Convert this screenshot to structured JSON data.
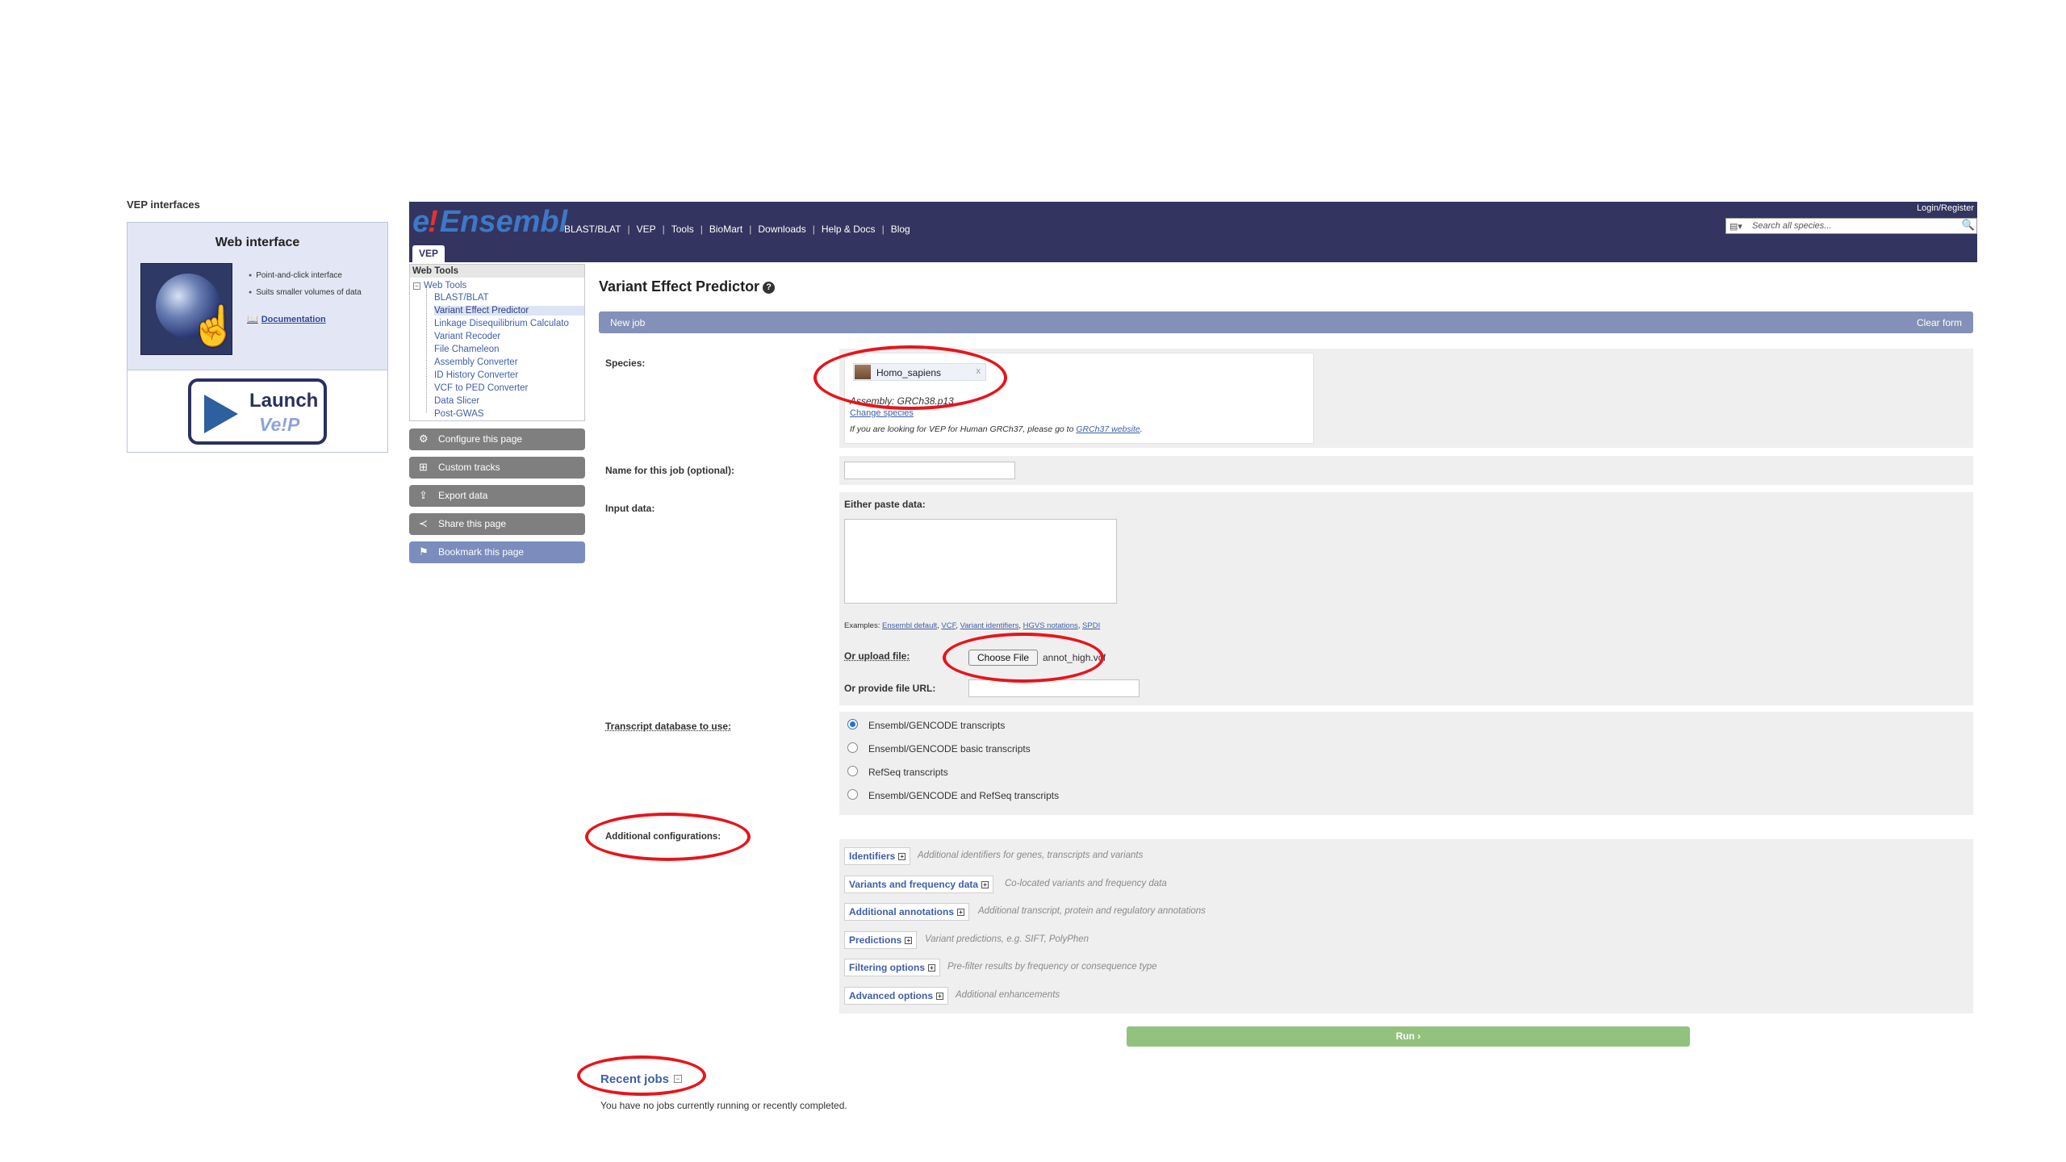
{
  "left_panel": {
    "heading": "VEP interfaces",
    "box_title": "Web interface",
    "features": [
      "Point-and-click interface",
      "Suits smaller volumes of data"
    ],
    "doc_link": "Documentation",
    "launch_line1": "Launch",
    "launch_line2": "Ve!P"
  },
  "header": {
    "logo_e": "e",
    "logo_bang": "!",
    "logo_text": "Ensembl",
    "nav": [
      "BLAST/BLAT",
      "VEP",
      "Tools",
      "BioMart",
      "Downloads",
      "Help & Docs",
      "Blog"
    ],
    "login": "Login/Register",
    "search_placeholder": "Search all species...",
    "tab": "VEP"
  },
  "sidebar": {
    "heading": "Web Tools",
    "root": "Web Tools",
    "items": [
      "BLAST/BLAT",
      "Variant Effect Predictor",
      "Linkage Disequilibrium Calculato",
      "Variant Recoder",
      "File Chameleon",
      "Assembly Converter",
      "ID History Converter",
      "VCF to PED Converter",
      "Data Slicer",
      "Post-GWAS"
    ],
    "selected_index": 1,
    "buttons": [
      {
        "label": "Configure this page",
        "icon": "gear-icon"
      },
      {
        "label": "Custom tracks",
        "icon": "custom-tracks-icon"
      },
      {
        "label": "Export data",
        "icon": "export-icon"
      },
      {
        "label": "Share this page",
        "icon": "share-icon"
      },
      {
        "label": "Bookmark this page",
        "icon": "bookmark-icon"
      }
    ]
  },
  "main": {
    "title": "Variant Effect Predictor",
    "new_job": "New job",
    "clear_form": "Clear form",
    "species_label": "Species:",
    "species_name": "Homo_sapiens",
    "species_remove": "x",
    "assembly": "Assembly: GRCh38.p13",
    "change_species": "Change species",
    "grch37_note_prefix": "If you are looking for VEP for Human GRCh37, please go to ",
    "grch37_link": "GRCh37 website",
    "grch37_note_suffix": ".",
    "job_name_label": "Name for this job (optional):",
    "job_name_value": "",
    "input_label": "Input data:",
    "paste_label": "Either paste data:",
    "paste_value": "",
    "examples_label": "Examples: ",
    "examples": [
      "Ensembl default",
      "VCF",
      "Variant identifiers",
      "HGVS notations",
      "SPDI"
    ],
    "upload_label": "Or upload file:",
    "choose_file": "Choose File",
    "file_name": "annot_high.vcf",
    "url_label": "Or provide file URL:",
    "url_value": "",
    "transcript_label": "Transcript database to use:",
    "transcript_options": [
      "Ensembl/GENCODE transcripts",
      "Ensembl/GENCODE basic transcripts",
      "RefSeq transcripts",
      "Ensembl/GENCODE and RefSeq transcripts"
    ],
    "transcript_selected": 0,
    "additional_label": "Additional configurations:",
    "configs": [
      {
        "label": "Identifiers",
        "desc": "Additional identifiers for genes, transcripts and variants"
      },
      {
        "label": "Variants and frequency data",
        "desc": "Co-located variants and frequency data"
      },
      {
        "label": "Additional annotations",
        "desc": "Additional transcript, protein and regulatory annotations"
      },
      {
        "label": "Predictions",
        "desc": "Variant predictions, e.g. SIFT, PolyPhen"
      },
      {
        "label": "Filtering options",
        "desc": "Pre-filter results by frequency or consequence type"
      },
      {
        "label": "Advanced options",
        "desc": "Additional enhancements"
      }
    ],
    "run": "Run ›",
    "recent_jobs": "Recent jobs",
    "no_jobs": "You have no jobs currently running or recently completed."
  },
  "colors": {
    "header_bg": "#33345f",
    "highlight_ring": "#e8141b",
    "run_button": "#92c27e",
    "link": "#3f5fa8"
  }
}
